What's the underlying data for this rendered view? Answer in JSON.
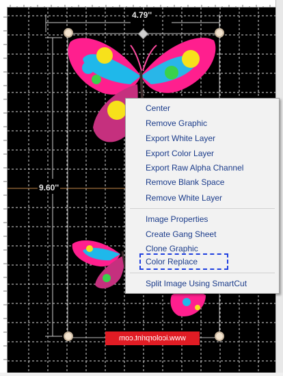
{
  "dimensions": {
    "width_label": "4.79''",
    "height_label": "9.60''"
  },
  "watermark": "www.icolorprint.com",
  "colors": {
    "canvas_bg": "#000000",
    "menu_bg": "#f2f2f2",
    "menu_text": "#1a3b8a",
    "watermark_bg": "#e01c24",
    "focus": "#1e3fe0"
  },
  "context_menu": {
    "group1": [
      "Center",
      "Remove Graphic",
      "Export White Layer",
      "Export Color Layer",
      "Export Raw Alpha Channel",
      "Remove Blank Space",
      "Remove White Layer"
    ],
    "group2": [
      "Image Properties",
      "Create Gang Sheet",
      "Clone Graphic",
      "Color Replace"
    ],
    "group3": [
      "Split Image Using SmartCut"
    ]
  }
}
